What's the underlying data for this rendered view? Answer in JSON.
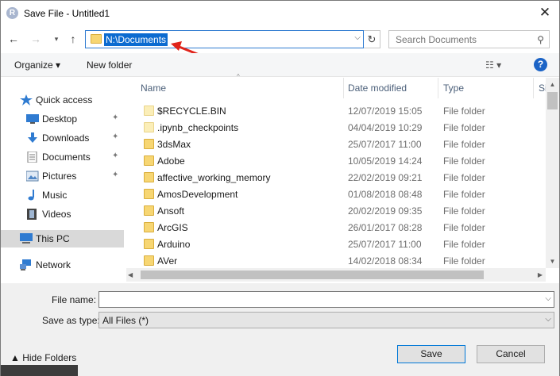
{
  "window": {
    "title": "Save File - Untitled1",
    "app_icon_letter": "R",
    "close_glyph": "✕"
  },
  "nav": {
    "back_glyph": "←",
    "forward_glyph": "→",
    "recent_glyph": "▾",
    "up_glyph": "↑",
    "address": "N:\\Documents",
    "address_dropdown_glyph": "⌵",
    "refresh_glyph": "↻",
    "search_placeholder": "Search Documents",
    "search_glyph": "⚲"
  },
  "toolbar": {
    "organize_label": "Organize ▾",
    "new_folder_label": "New folder",
    "view_glyph": "☷ ▾",
    "help_glyph": "?"
  },
  "sidebar": {
    "items": [
      {
        "label": "Quick access",
        "icon": "star-icon",
        "pinned": false
      },
      {
        "label": "Desktop",
        "icon": "desktop-icon",
        "pinned": true
      },
      {
        "label": "Downloads",
        "icon": "download-icon",
        "pinned": true
      },
      {
        "label": "Documents",
        "icon": "documents-icon",
        "pinned": true
      },
      {
        "label": "Pictures",
        "icon": "pictures-icon",
        "pinned": true
      },
      {
        "label": "Music",
        "icon": "music-icon",
        "pinned": false
      },
      {
        "label": "Videos",
        "icon": "videos-icon",
        "pinned": false
      },
      {
        "label": "This PC",
        "icon": "computer-icon",
        "pinned": false
      },
      {
        "label": "Network",
        "icon": "network-icon",
        "pinned": false
      }
    ],
    "pin_glyph": "📌"
  },
  "filelist": {
    "columns": {
      "name": "Name",
      "date": "Date modified",
      "type": "Type",
      "size": "Si"
    },
    "sort_glyph": "^",
    "rows": [
      {
        "name": "$RECYCLE.BIN",
        "date": "12/07/2019 15:05",
        "type": "File folder",
        "light": true
      },
      {
        "name": ".ipynb_checkpoints",
        "date": "04/04/2019 10:29",
        "type": "File folder",
        "light": true
      },
      {
        "name": "3dsMax",
        "date": "25/07/2017 11:00",
        "type": "File folder",
        "light": false
      },
      {
        "name": "Adobe",
        "date": "10/05/2019 14:24",
        "type": "File folder",
        "light": false
      },
      {
        "name": "affective_working_memory",
        "date": "22/02/2019 09:21",
        "type": "File folder",
        "light": false
      },
      {
        "name": "AmosDevelopment",
        "date": "01/08/2018 08:48",
        "type": "File folder",
        "light": false
      },
      {
        "name": "Ansoft",
        "date": "20/02/2019 09:35",
        "type": "File folder",
        "light": false
      },
      {
        "name": "ArcGIS",
        "date": "26/01/2017 08:28",
        "type": "File folder",
        "light": false
      },
      {
        "name": "Arduino",
        "date": "25/07/2017 11:00",
        "type": "File folder",
        "light": false
      },
      {
        "name": "AVer",
        "date": "14/02/2018 08:34",
        "type": "File folder",
        "light": false
      }
    ]
  },
  "form": {
    "file_name_label": "File name:",
    "file_name_value": "",
    "save_as_type_label": "Save as type:",
    "save_as_type_value": "All Files  (*)",
    "dropdown_glyph": "⌵"
  },
  "footer": {
    "hide_folders_label": "▲  Hide Folders",
    "save_label": "Save",
    "cancel_label": "Cancel"
  },
  "colors": {
    "accent": "#0078d7",
    "address_highlight": "#0b6bd0",
    "folder": "#f7d673",
    "annotation_arrow": "#e0241b"
  }
}
